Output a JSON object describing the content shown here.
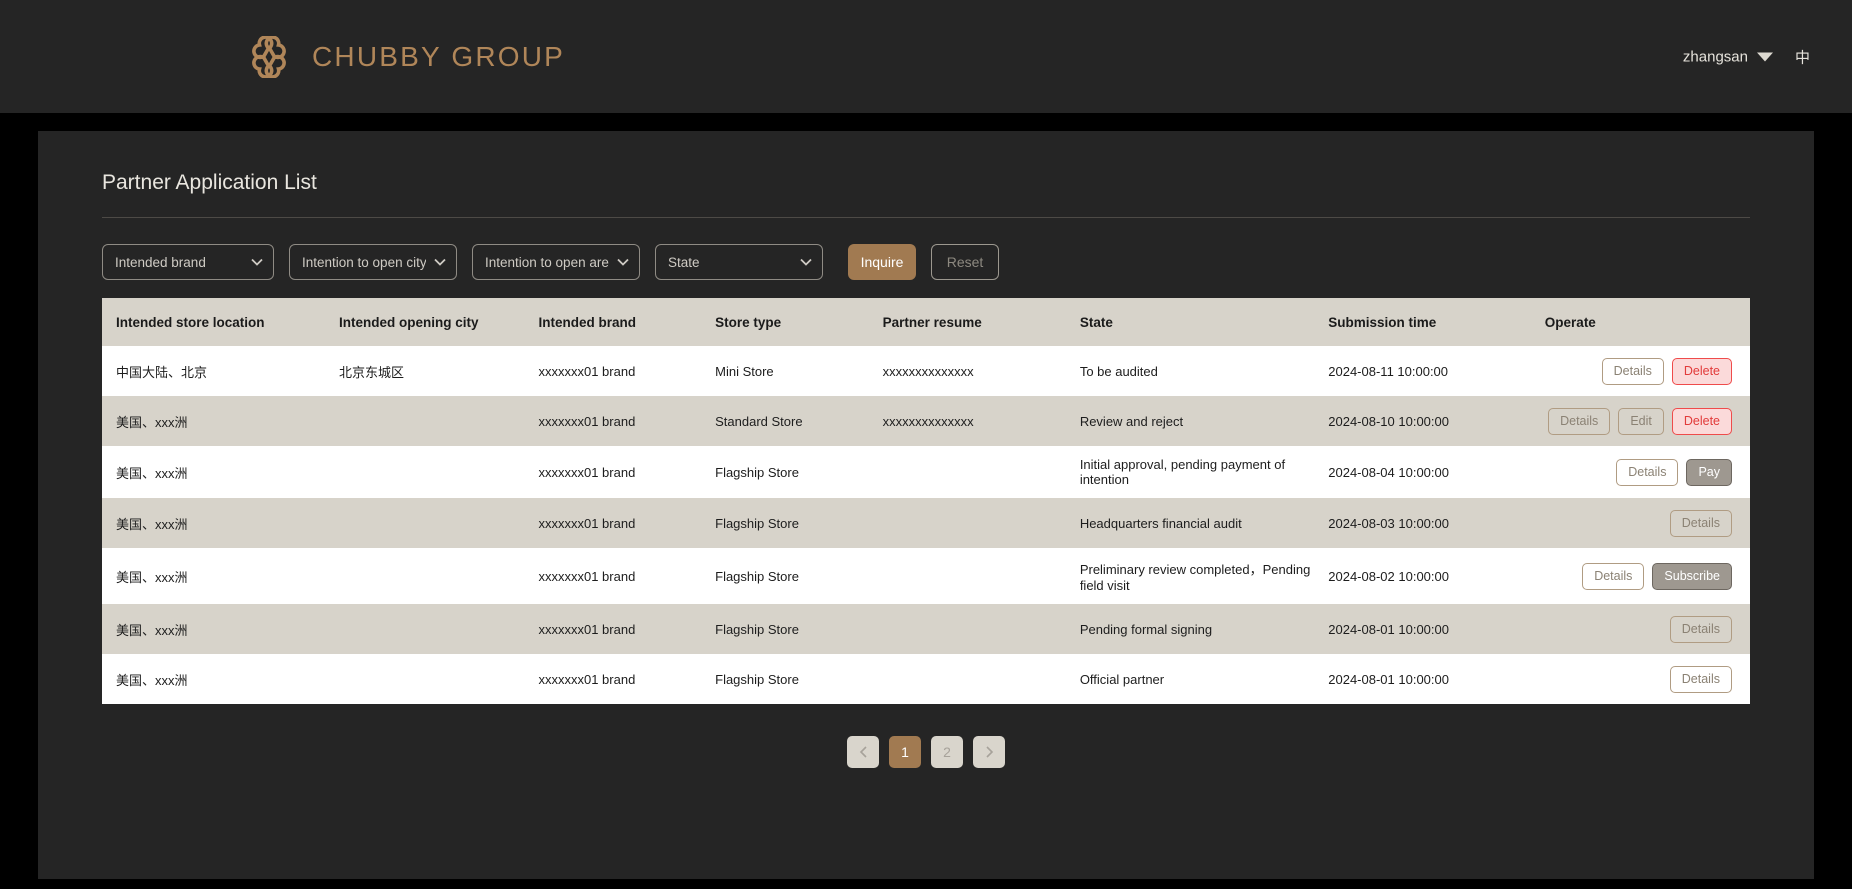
{
  "header": {
    "brand_name": "CHUBBY GROUP",
    "logo_icon": "clover-logo-icon",
    "brand_color": "#b08659",
    "username": "zhangsan",
    "user_caret_icon": "chevron-down-icon",
    "language_label": "中"
  },
  "page": {
    "title": "Partner Application List"
  },
  "filters": {
    "brand": {
      "label": "Intended brand",
      "options": [
        "Intended brand"
      ]
    },
    "city": {
      "label": "Intention to open city",
      "options": [
        "Intention to open city"
      ]
    },
    "area": {
      "label": "Intention to open area",
      "options": [
        "Intention to open area"
      ]
    },
    "state": {
      "label": "State",
      "options": [
        "State"
      ]
    },
    "inquire_label": "Inquire",
    "reset_label": "Reset",
    "inquire_color": "#a17a51"
  },
  "table": {
    "columns": [
      "Intended store location",
      "Intended opening city",
      "Intended brand",
      "Store type",
      "Partner resume",
      "State",
      "Submission time",
      "Operate"
    ],
    "rows": [
      {
        "location": "中国大陆、北京",
        "city": "北京东城区",
        "brand": "xxxxxxx01 brand",
        "store_type": "Mini Store",
        "resume": "xxxxxxxxxxxxxx",
        "state": "To be audited",
        "submitted": "2024-08-11 10:00:00",
        "actions": [
          {
            "label": "Details",
            "kind": "details"
          },
          {
            "label": "Delete",
            "kind": "delete"
          }
        ]
      },
      {
        "location": "美国、xxx洲",
        "city": "",
        "brand": "xxxxxxx01 brand",
        "store_type": "Standard Store",
        "resume": "xxxxxxxxxxxxxx",
        "state": "Review and reject",
        "submitted": "2024-08-10 10:00:00",
        "actions": [
          {
            "label": "Details",
            "kind": "details"
          },
          {
            "label": "Edit",
            "kind": "edit"
          },
          {
            "label": "Delete",
            "kind": "delete"
          }
        ]
      },
      {
        "location": "美国、xxx洲",
        "city": "",
        "brand": "xxxxxxx01 brand",
        "store_type": "Flagship Store",
        "resume": "",
        "state": "Initial approval, pending payment of intention",
        "submitted": "2024-08-04 10:00:00",
        "actions": [
          {
            "label": "Details",
            "kind": "details"
          },
          {
            "label": "Pay",
            "kind": "pay"
          }
        ]
      },
      {
        "location": "美国、xxx洲",
        "city": "",
        "brand": "xxxxxxx01 brand",
        "store_type": "Flagship Store",
        "resume": "",
        "state": "Headquarters financial audit",
        "submitted": "2024-08-03 10:00:00",
        "actions": [
          {
            "label": "Details",
            "kind": "details"
          }
        ]
      },
      {
        "location": "美国、xxx洲",
        "city": "",
        "brand": "xxxxxxx01 brand",
        "store_type": "Flagship Store",
        "resume": "",
        "state": "Preliminary review completed，Pending field visit",
        "submitted": "2024-08-02 10:00:00",
        "actions": [
          {
            "label": "Details",
            "kind": "details"
          },
          {
            "label": "Subscribe",
            "kind": "subscribe"
          }
        ]
      },
      {
        "location": "美国、xxx洲",
        "city": "",
        "brand": "xxxxxxx01 brand",
        "store_type": "Flagship Store",
        "resume": "",
        "state": "Pending formal signing",
        "submitted": "2024-08-01 10:00:00",
        "actions": [
          {
            "label": "Details",
            "kind": "details"
          }
        ]
      },
      {
        "location": "美国、xxx洲",
        "city": "",
        "brand": "xxxxxxx01 brand",
        "store_type": "Flagship Store",
        "resume": "",
        "state": "Official partner",
        "submitted": "2024-08-01 10:00:00",
        "actions": [
          {
            "label": "Details",
            "kind": "details"
          }
        ]
      }
    ]
  },
  "pagination": {
    "prev_icon": "chevron-left-icon",
    "next_icon": "chevron-right-icon",
    "pages": [
      "1",
      "2"
    ],
    "current_page": "1",
    "active_color": "#a17a51"
  }
}
